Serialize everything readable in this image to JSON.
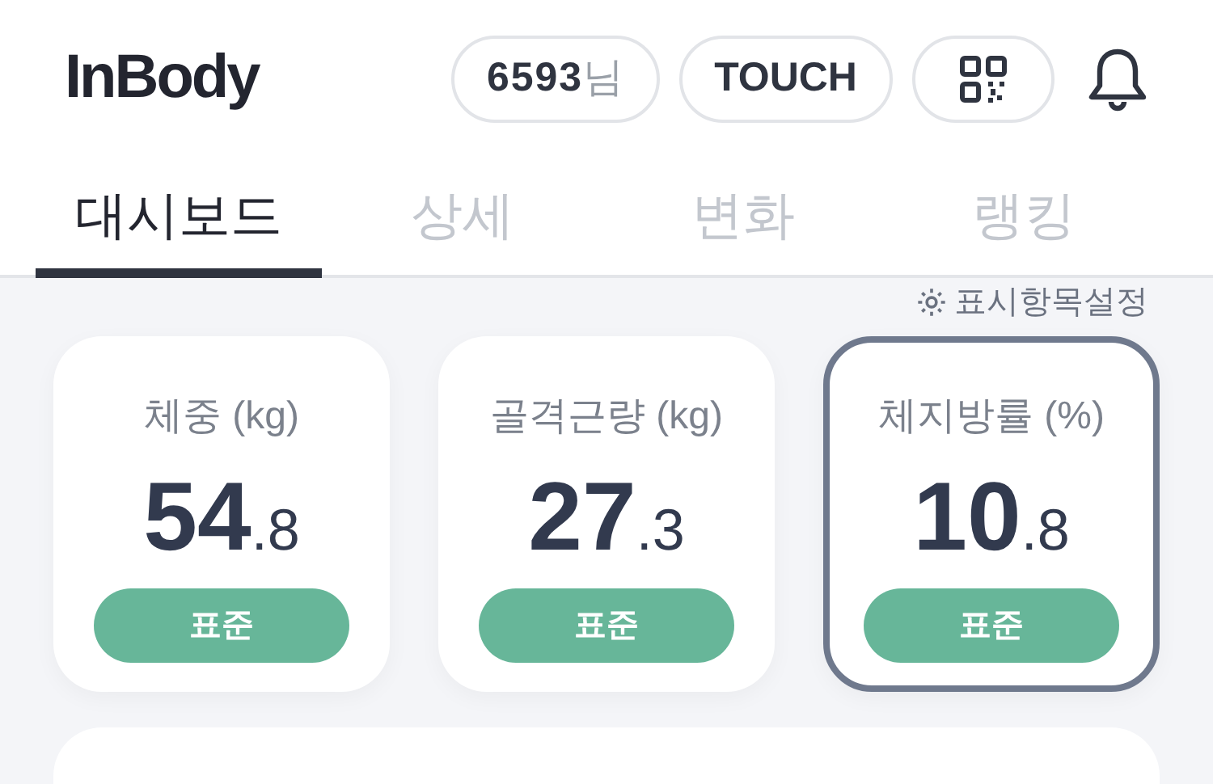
{
  "header": {
    "logo": "InBody",
    "user_badge": {
      "id": "6593",
      "suffix": "님"
    },
    "touch_button": "TOUCH"
  },
  "tabs": [
    {
      "label": "대시보드",
      "selected": true
    },
    {
      "label": "상세",
      "selected": false
    },
    {
      "label": "변화",
      "selected": false
    },
    {
      "label": "랭킹",
      "selected": false
    }
  ],
  "settings_link": "표시항목설정",
  "metrics": [
    {
      "label": "체중 (kg)",
      "integer": "54",
      "decimal": ".8",
      "status": "표준",
      "selected": false
    },
    {
      "label": "골격근량 (kg)",
      "integer": "27",
      "decimal": ".3",
      "status": "표준",
      "selected": false
    },
    {
      "label": "체지방률 (%)",
      "integer": "10",
      "decimal": ".8",
      "status": "표준",
      "selected": true
    }
  ]
}
